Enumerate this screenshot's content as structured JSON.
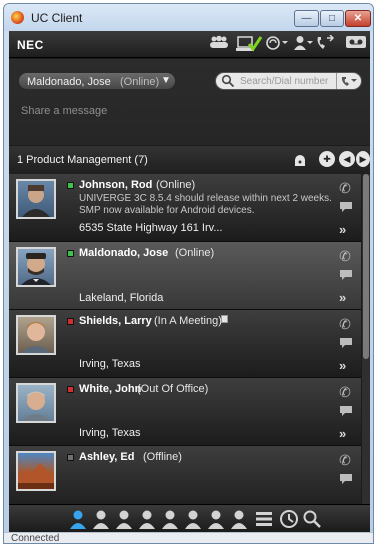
{
  "window": {
    "title": "UC Client",
    "minimize": "—",
    "maximize": "□",
    "close": "✕"
  },
  "toolbar": {
    "brand": "NEC",
    "icons": [
      "group-icon",
      "presence-check-icon",
      "dialpad-icon",
      "user-add-icon",
      "call-forward-icon",
      "voicemail-icon"
    ]
  },
  "presence": {
    "name": "Maldonado, Jose",
    "state": "(Online)",
    "caret": "▼"
  },
  "search": {
    "placeholder": "Search/Dial number"
  },
  "share": {
    "placeholder": "Share a message"
  },
  "group": {
    "title": "1 Product Management (7)"
  },
  "contacts": [
    {
      "name": "Johnson, Rod",
      "state": "(Online)",
      "status_color": "#3cc34a",
      "message": "UNIVERGE 3C 8.5.4 should release within next 2 weeks. SMP now available for Android devices.",
      "location": "6535 State Highway 161 Irv...",
      "has_note": false
    },
    {
      "name": "Maldonado, Jose",
      "state": "(Online)",
      "status_color": "#3cc34a",
      "message": "",
      "location": "Lakeland, Florida",
      "has_note": false
    },
    {
      "name": "Shields, Larry",
      "state": "(In A Meeting)",
      "status_color": "#d23030",
      "message": "",
      "location": "Irving, Texas",
      "has_note": true
    },
    {
      "name": "White, John",
      "state": "(Out Of Office)",
      "status_color": "#d23030",
      "message": "",
      "location": "Irving, Texas",
      "has_note": false
    },
    {
      "name": "Ashley, Ed",
      "state": "(Offline)",
      "status_color": "#6f6f6f",
      "message": "",
      "location": "",
      "has_note": false
    }
  ],
  "more_glyph": "»",
  "footer": {
    "status": "Connected"
  }
}
